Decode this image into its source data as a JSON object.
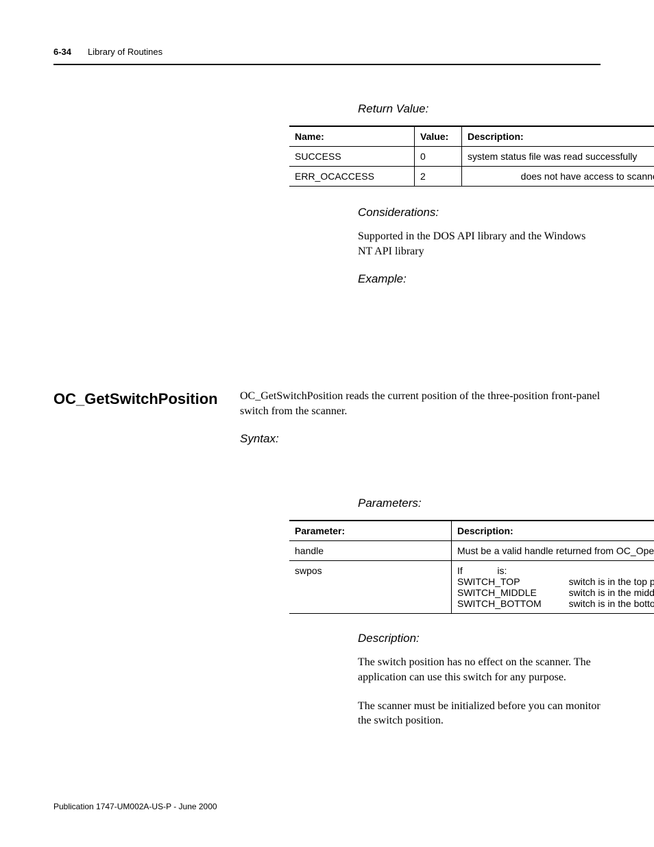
{
  "header": {
    "page_number": "6-34",
    "section": "Library of Routines"
  },
  "return_value": {
    "heading": "Return Value:",
    "columns": {
      "name": "Name:",
      "value": "Value:",
      "desc": "Description:"
    },
    "rows": [
      {
        "name": "SUCCESS",
        "value": "0",
        "desc": "system status file was read successfully"
      },
      {
        "name": "ERR_OCACCESS",
        "value": "2",
        "desc": "does not have access to scanner"
      }
    ]
  },
  "considerations": {
    "heading": "Considerations:",
    "text": "Supported in the DOS API library and the Windows NT API library"
  },
  "example_heading": "Example:",
  "function": {
    "name": "OC_GetSwitchPosition",
    "intro": "OC_GetSwitchPosition reads the current position of the three-position front-panel switch from the scanner."
  },
  "syntax_heading": "Syntax:",
  "parameters": {
    "heading": "Parameters:",
    "columns": {
      "param": "Parameter:",
      "desc": "Description:"
    },
    "rows": [
      {
        "param": "handle",
        "desc": "Must be a valid handle returned from OC_OpenScanner"
      },
      {
        "param": "swpos",
        "if_label": "If",
        "is_label": "is:",
        "options": [
          {
            "name": "SWITCH_TOP",
            "desc": "switch is in the top position"
          },
          {
            "name": "SWITCH_MIDDLE",
            "desc": "switch is in the middle position"
          },
          {
            "name": "SWITCH_BOTTOM",
            "desc": "switch is in the bottom position"
          }
        ]
      }
    ]
  },
  "description": {
    "heading": "Description:",
    "para1": "The switch position has no effect on the scanner. The application can use this switch for any purpose.",
    "para2": "The scanner must be initialized before you can monitor the switch position."
  },
  "footer": "Publication 1747-UM002A-US-P - June 2000"
}
